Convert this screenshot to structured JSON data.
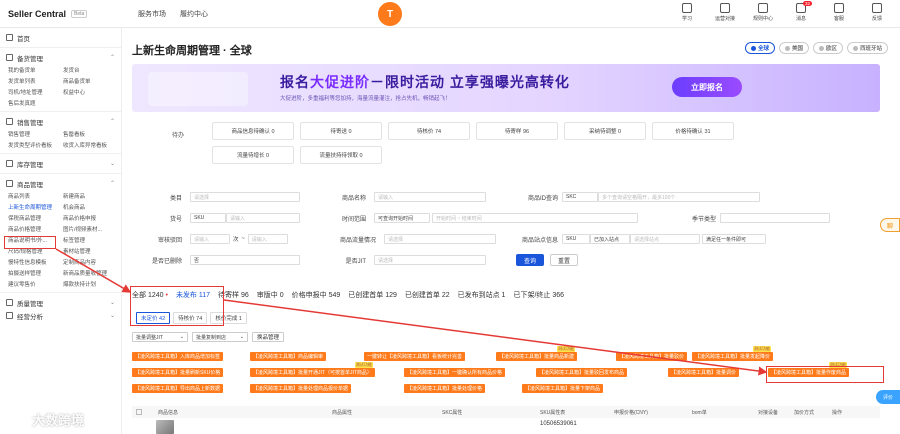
{
  "app": {
    "brand": "Seller Central",
    "brand_badge": "Beta",
    "nav": [
      "服务市场",
      "履约中心"
    ]
  },
  "top_icons": [
    {
      "label": "学习",
      "badge": ""
    },
    {
      "label": "运营对接",
      "badge": ""
    },
    {
      "label": "规则中心",
      "badge": ""
    },
    {
      "label": "消息",
      "badge": "32"
    },
    {
      "label": "客服",
      "badge": ""
    },
    {
      "label": "反馈",
      "badge": ""
    }
  ],
  "sidebar": {
    "home": "首页",
    "groups": [
      {
        "label": "备货管理",
        "rows": [
          [
            "我的备货单",
            "发货台"
          ],
          [
            "发货单列表",
            "商品备货单"
          ],
          [
            "司机/地址管理",
            "权益中心"
          ],
          [
            "售后发真题",
            ""
          ]
        ]
      },
      {
        "label": "销售管理",
        "rows": [
          [
            "销售管理",
            "售罄看板"
          ],
          [
            "发货类型评价看板",
            "收货入库异常看板"
          ]
        ]
      },
      {
        "label": "库存管理",
        "rows": []
      },
      {
        "label": "商品管理",
        "rows": [
          [
            "商品列表",
            "新建商品"
          ],
          [
            "上新生命周期管理",
            "机会商品"
          ],
          [
            "保税商品管理",
            "商品价格申报"
          ],
          [
            "商品价格管理",
            "图片/视频素材..."
          ],
          [
            "商品说明书/外...",
            "标签管理"
          ],
          [
            "尺码/规格管理",
            "素材站管理"
          ],
          [
            "慢特性信息模板",
            "定制商品内容"
          ],
          [
            "拍摄送样管理",
            "新商品质量收管理"
          ],
          [
            "建议零售价",
            "爆款扶持计划"
          ]
        ]
      },
      {
        "label": "质量管理",
        "rows": []
      },
      {
        "label": "经营分析",
        "rows": []
      }
    ]
  },
  "main": {
    "title": "上新生命周期管理 · 全球",
    "regions": [
      "全球",
      "美国",
      "欧区",
      "西班牙站"
    ],
    "banner": {
      "main_pre": "报名",
      "main_em": "大促进阶",
      "main_post": "－限时活动  立享强曝光高转化",
      "sub": "大促进阶，多重福利等您加持，海量流量灌注，抢占先机，畅销起飞！",
      "button": "立即报名"
    },
    "status_label": "待办",
    "status_cards": [
      "商品信息待确认 0",
      "待寄送 0",
      "待核价 74",
      "待寄样 96",
      "采纳待调整 0",
      "价格待确认 31",
      "流量待增长 0",
      "流量扶持待领取 0"
    ],
    "filters": {
      "category_label": "类目",
      "category_ph": "请选择",
      "name_label": "商品名称",
      "name_ph": "请输入",
      "id_label": "商品ID查询",
      "id_select": "SKC",
      "id_ph": "多个查询请空格隔开，最多100个",
      "code_label": "货号",
      "code_select": "SKU",
      "code_ph": "请输入",
      "time_label": "时间范围",
      "time_select": "可查询开始时间",
      "time_ph": "开始时间  ~  结束时间",
      "season_label": "季节类型",
      "season_ph": "",
      "review_label": "审核驳回",
      "review_ph": "请输入",
      "review_unit": "次",
      "traffic_label": "商品流量情况",
      "traffic_ph": "请选择",
      "extra_label": "商品站点信息",
      "extra_select": "SKU",
      "extra_sel2": "已加入站点",
      "extra_ph": "请选择站点",
      "extra_sel3": "满足任一条件即可",
      "deleted_label": "是否已删除",
      "deleted_val": "否",
      "jit_label": "是否JIT",
      "jit_ph": "请选择",
      "query": "查询",
      "reset": "重置"
    },
    "tabs": [
      "全部 1240",
      "未发布 117",
      "待寄样 96",
      "审版中 0",
      "价格申报中 549",
      "已创建首单 129",
      "已创建首单 22",
      "已发布到站点 1",
      "已下架/终止 366"
    ],
    "subtabs": [
      "未定价 42",
      "待核价 74",
      "核价完成 1"
    ],
    "toolbar": {
      "sel1": "批量调整JIT",
      "sel2": "批量复制到店",
      "btn": "换品管理"
    },
    "plugins": [
      "【凌风跨境工具箱】入库商品增加标签",
      "【凌风跨境工具箱】商品编辑审",
      "一键转让【凌风跨境工具箱】看板统计完善",
      "【凌风跨境工具箱】批量商品新建",
      "【凌风跨境工具箱】批量驳价",
      "【凌风跨境工具箱】批量发起降价",
      "【凌风跨境工具箱】批量刷新SKU价格",
      "【凌风跨境工具箱】批量开通JIT（可按首单JIT商品）",
      "【凌风跨境工具箱】一键确认所有商品价格",
      "【凌风跨境工具箱】批量驳回发布商品",
      "【凌风跨境工具箱】批量调价",
      "【凌风跨境工具箱】批量作废商品",
      "【凌风跨境工具箱】导出商品上新数据",
      "【凌风跨境工具箱】批量处理商品报价单据",
      "【凌风跨境工具箱】批量处理价格",
      "【凌风跨境工具箱】批量下架商品"
    ],
    "plugin_new": "测试功能",
    "table_headers": [
      "商品信息",
      "商品属性",
      "SKC属性",
      "SKU属性表",
      "申报价格(CNY)",
      "bom单",
      "对接设备",
      "加价方式",
      "操作"
    ],
    "first_row": {
      "sku_id": "10506539061"
    }
  },
  "float": {
    "chat": "聊",
    "eval": "评价"
  },
  "watermark": "大数跨境"
}
